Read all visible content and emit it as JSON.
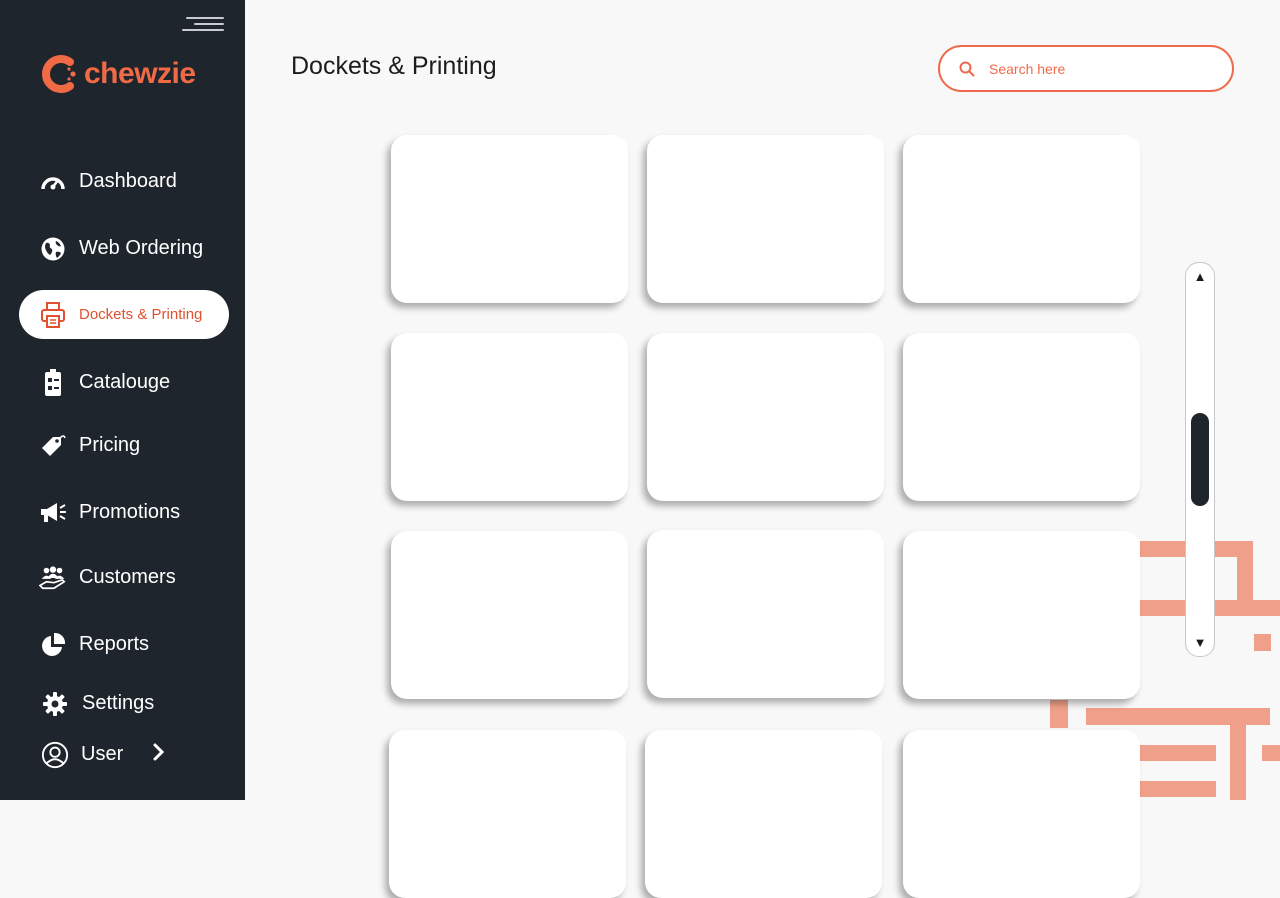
{
  "app": {
    "brand": "chewzie",
    "brand_color": "#f06a45",
    "active_color": "#e2512f",
    "sidebar_bg": "#1f252d"
  },
  "sidebar": {
    "items": [
      {
        "label": "Dashboard",
        "icon": "speedometer-icon"
      },
      {
        "label": "Web Ordering",
        "icon": "globe-icon"
      },
      {
        "label": "Dockets & Printing",
        "icon": "printer-icon",
        "active": true
      },
      {
        "label": "Catalouge",
        "icon": "catalogue-icon"
      },
      {
        "label": "Pricing",
        "icon": "price-tag-icon"
      },
      {
        "label": "Promotions",
        "icon": "megaphone-icon"
      },
      {
        "label": "Customers",
        "icon": "customers-icon"
      },
      {
        "label": "Reports",
        "icon": "pie-chart-icon"
      },
      {
        "label": "Settings",
        "icon": "gear-icon"
      },
      {
        "label": "User",
        "icon": "user-icon"
      }
    ]
  },
  "header": {
    "title": "Dockets & Printing",
    "search": {
      "placeholder": "Search here",
      "value": ""
    }
  },
  "cards": {
    "rows": 4,
    "columns": 3
  },
  "scrollbar": {
    "up": "▲",
    "down": "▼"
  }
}
